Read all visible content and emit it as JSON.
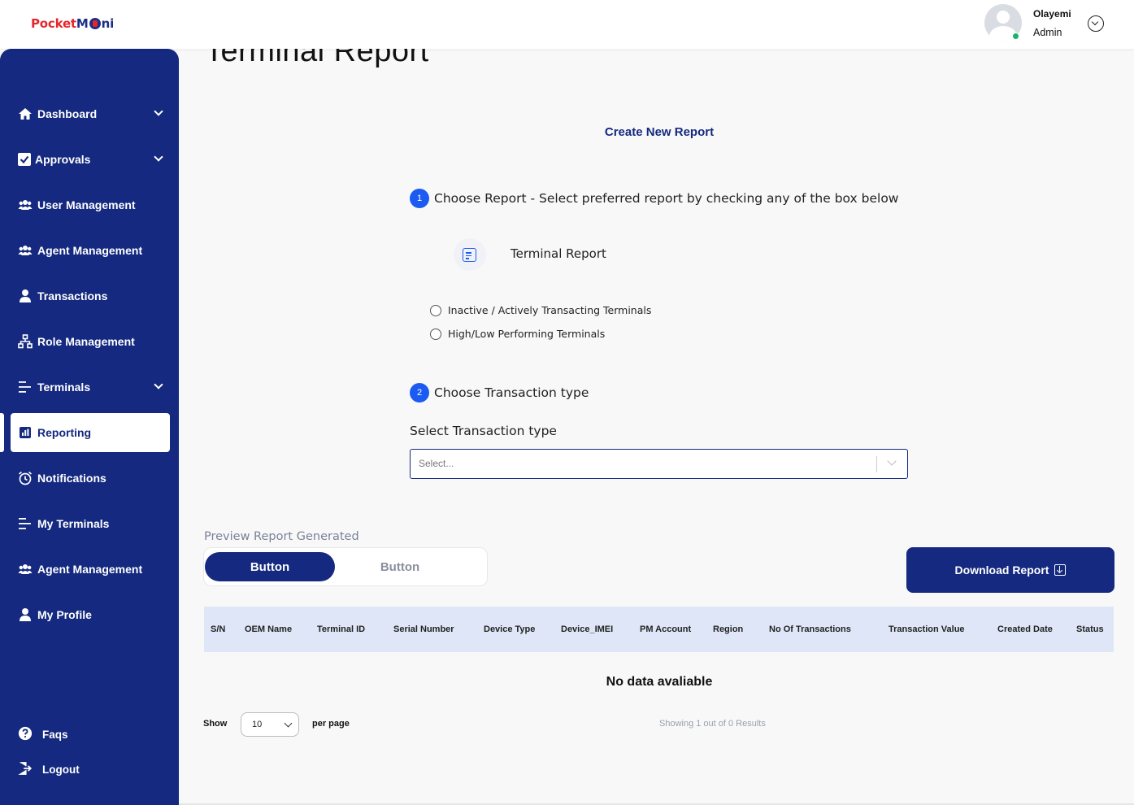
{
  "brand": {
    "part1": "Pocket",
    "part2": "M",
    "part3": "ni"
  },
  "user": {
    "name": "Olayemi",
    "role": "Admin"
  },
  "page_title": "Terminal Report",
  "sidebar": {
    "items": [
      {
        "label": "Dashboard",
        "icon": "home-icon",
        "has_chevron": true
      },
      {
        "label": "Approvals",
        "icon": "check-square-icon",
        "has_chevron": true
      },
      {
        "label": "User Management",
        "icon": "users-icon",
        "has_chevron": false
      },
      {
        "label": "Agent Management",
        "icon": "users-icon",
        "has_chevron": false
      },
      {
        "label": "Transactions",
        "icon": "user-icon",
        "has_chevron": false
      },
      {
        "label": "Role Management",
        "icon": "hierarchy-icon",
        "has_chevron": false
      },
      {
        "label": "Terminals",
        "icon": "lines-icon",
        "has_chevron": true
      },
      {
        "label": "Reporting",
        "icon": "chart-icon",
        "has_chevron": false,
        "active": true
      },
      {
        "label": "Notifications",
        "icon": "alarm-icon",
        "has_chevron": false
      },
      {
        "label": "My Terminals",
        "icon": "lines-icon",
        "has_chevron": false
      },
      {
        "label": "Agent Management",
        "icon": "users-icon",
        "has_chevron": false
      },
      {
        "label": "My Profile",
        "icon": "user-icon",
        "has_chevron": false
      }
    ],
    "bottom": [
      {
        "label": "Faqs",
        "icon": "question-icon"
      },
      {
        "label": "Logout",
        "icon": "logout-icon"
      }
    ]
  },
  "create": {
    "title": "Create New Report",
    "step1": {
      "num": "1",
      "text": "Choose Report - Select preferred report by checking any of the box below"
    },
    "report_name": "Terminal Report",
    "options": [
      "Inactive / Actively Transacting Terminals",
      "High/Low Performing Terminals"
    ],
    "step2": {
      "num": "2",
      "text": "Choose Transaction type"
    },
    "select_label": "Select Transaction type",
    "select_placeholder": "Select..."
  },
  "preview": {
    "label": "Preview Report Generated",
    "toggle": [
      "Button",
      "Button"
    ],
    "download_label": "Download Report"
  },
  "table": {
    "columns": [
      "S/N",
      "OEM Name",
      "Terminal ID",
      "Serial Number",
      "Device Type",
      "Device_IMEI",
      "PM Account",
      "Region",
      "No Of Transactions",
      "Transaction Value",
      "Created Date",
      "Status"
    ],
    "empty_message": "No data avaliable"
  },
  "pagination": {
    "show_label": "Show",
    "per_page_value": "10",
    "per_page_label": "per page",
    "results_text": "Showing 1 out of 0 Results"
  },
  "colors": {
    "primary": "#14297f",
    "accent": "#1c5bf2",
    "brand_red": "#e5262d",
    "online": "#19b46c"
  }
}
